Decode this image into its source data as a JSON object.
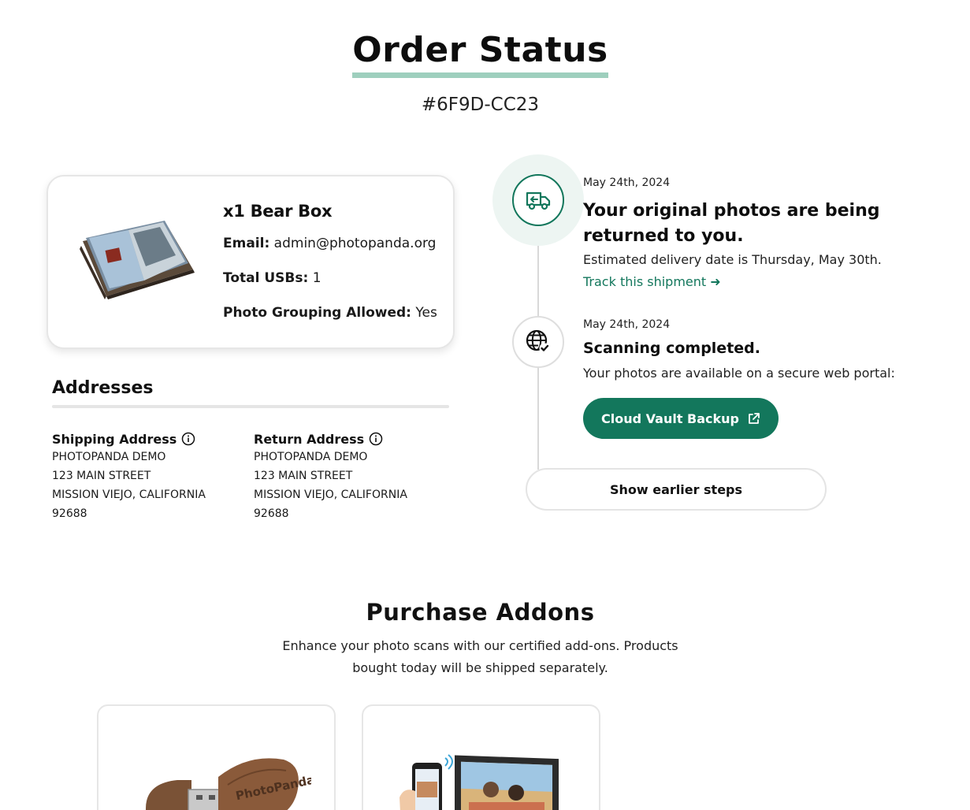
{
  "header": {
    "title": "Order Status",
    "order_id": "#6F9D-CC23"
  },
  "product": {
    "name": "x1 Bear Box",
    "email_label": "Email:",
    "email_value": "admin@photopanda.org",
    "usbs_label": "Total USBs:",
    "usbs_value": "1",
    "grouping_label": "Photo Grouping Allowed:",
    "grouping_value": "Yes"
  },
  "addresses": {
    "title": "Addresses",
    "shipping": {
      "label": "Shipping Address",
      "lines": [
        "PHOTOPANDA DEMO",
        "123 MAIN STREET",
        "MISSION VIEJO, CALIFORNIA",
        "92688"
      ]
    },
    "return": {
      "label": "Return Address",
      "lines": [
        "PHOTOPANDA DEMO",
        "123 MAIN STREET",
        "MISSION VIEJO, CALIFORNIA",
        "92688"
      ]
    }
  },
  "timeline": {
    "steps": [
      {
        "date": "May 24th, 2024",
        "title_line1": "Your original photos are being",
        "title_line2": "returned to you.",
        "body": "Estimated delivery date is Thursday, May 30th.",
        "link": "Track this shipment ➜",
        "icon": "truck-return-icon"
      },
      {
        "date": "May 24th, 2024",
        "title": "Scanning completed.",
        "body": "Your photos are available on a secure web portal:",
        "button": "Cloud Vault Backup",
        "icon": "globe-check-icon"
      }
    ],
    "earlier_button": "Show earlier steps"
  },
  "addons": {
    "title": "Purchase Addons",
    "description_line1": "Enhance your photo scans with our certified add-ons. Products",
    "description_line2": "bought today will be shipped separately.",
    "usb_logo_text": "PhotoPanda"
  },
  "colors": {
    "accent": "#13775c",
    "title_underline": "#9ecfbd",
    "halo": "#edf5f2",
    "border": "#e6e6e6"
  }
}
